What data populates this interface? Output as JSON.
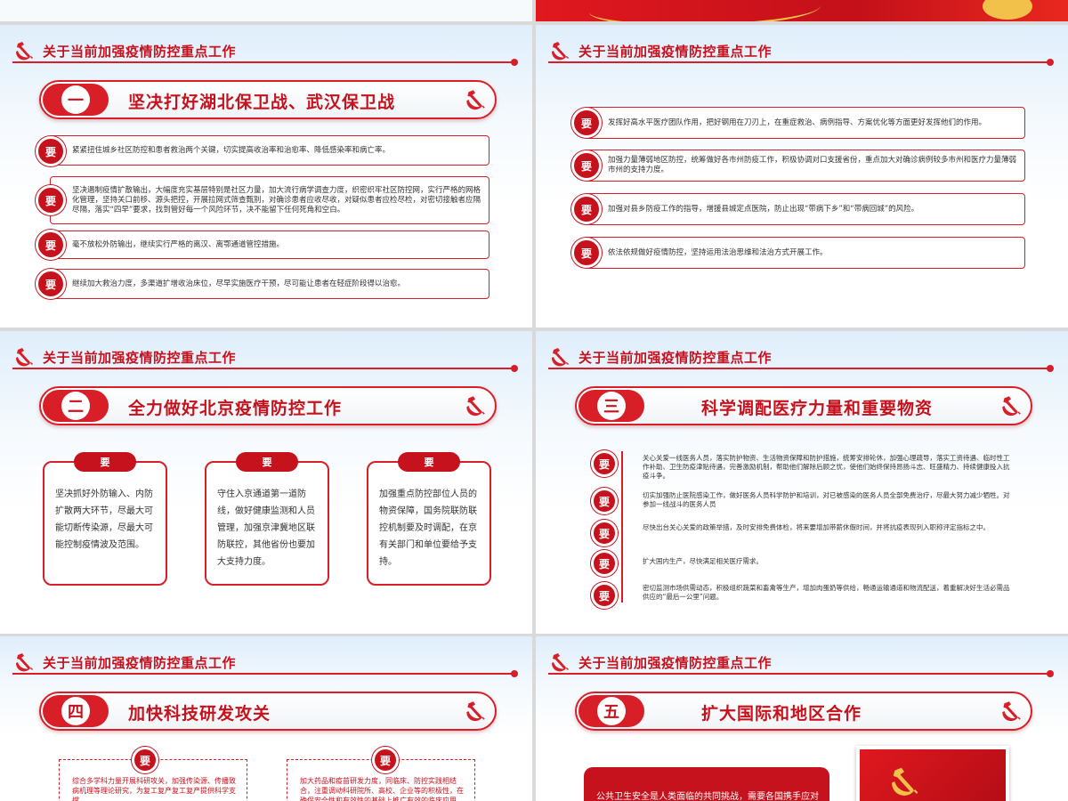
{
  "header_title": "关于当前加强疫情防控重点工作",
  "yao": "要",
  "slide1": {
    "num": "一",
    "banner": "坚决打好湖北保卫战、武汉保卫战",
    "items": [
      "紧紧扭住城乡社区防控和患者救治两个关键，切实提高收治率和治愈率、降低感染率和病亡率。",
      "坚决遏制疫情扩散输出，大幅度充实基层特别是社区力量，加大流行病学调查力度，织密织牢社区防控网，实行严格的网格化管理，坚持关口前移、源头把控，开展拉网式筛查甄别，对确诊患者应收尽收，对疑似患者应检尽检，对密切接触者应隔尽隔，落实“四早”要求，找到管好每一个风险环节，决不能留下任何死角和空白。",
      "毫不放松外防输出，继续实行严格的离汉、离鄂通道管控措施。",
      "继续加大救治力度，多渠道扩增收治床位，尽早实施医疗干预，尽可能让患者在轻症阶段得以治愈。"
    ]
  },
  "slide2": {
    "items": [
      "发挥好高水平医疗团队作用，把好钢用在刀刃上，在重症救治、病例指导、方案优化等方面更好发挥他们的作用。",
      "加强力量薄弱地区防控，统筹做好各市州防疫工作，积极协调对口支援省份，重点加大对确诊病例较多市州和医疗力量薄弱市州的支持力度。",
      "加强对县乡防疫工作的指导，增援县城定点医院，防止出现“带病下乡”和“带病回城”的风险。",
      "依法依规做好疫情防控，坚持运用法治思维和法治方式开展工作。"
    ]
  },
  "slide3": {
    "num": "二",
    "banner": "全力做好北京疫情防控工作",
    "cards": [
      "坚决抓好外防输入、内防扩散两大环节，尽最大可能切断传染源，尽最大可能控制疫情波及范围。",
      "守住入京通道第一道防线，做好健康监测和人员管理，加强京津冀地区联防联控，其他省份也要加大支持力度。",
      "加强重点防控部位人员的物资保障，国务院联防联控机制要及时调配，在京有关部门和单位要给予支持。"
    ]
  },
  "slide4": {
    "num": "三",
    "banner": "科学调配医疗力量和重要物资",
    "items": [
      "关心关爱一线医务人员，落实防护物资、生活物资保障和防护措施，统筹安排轮休，加强心理疏导，落实工资待遇、临时性工作补助、卫生防疫津贴待遇，完善激励机制，帮助他们解除后顾之忧，使他们始终保持昂扬斗志、旺盛精力、持续健康投入抗疫斗争。",
      "切实加强防止医院感染工作，做好医务人员科学防护和培训，对已被感染的医务人员全部免费治疗，尽最大努力减少牺牲。对参加一线战斗的医务人员",
      "尽快出台关心关爱的政策举措，及时安排免费体检，将来要增加带薪休假时间，并将抗疫表现列入职称评定指标之中。",
      "扩大国内生产，尽快满足相关医疗需求。",
      "密切监测市场供需动态，积极组织蔬菜和畜禽等生产，增加肉蛋奶等供给，畅通运输通道和物流配送，着重解决好生活必需品供应的“最后一公里”问题。"
    ]
  },
  "slide5": {
    "num": "四",
    "banner": "加快科技研发攻关",
    "boxes": [
      "综合多学科力量开展科研攻关，加强传染源、传播致病机理等理论研究，为复工复产复工复产提供科学支撑。",
      "加大药品和疫苗研发力度，同临床、防控实践相结合，注重调动科研院所、高校、企业等的积极性，在确保安全性和有效性的基础上推广有效的临床应用。"
    ]
  },
  "slide6": {
    "num": "五",
    "banner": "扩大国际和地区合作",
    "text": "公共卫生安全是人类面临的共同挑战，需要各国携手应对"
  },
  "colors": {
    "red": "#d81e27",
    "dark_red": "#c6121d"
  },
  "icons": [
    "hammer-sickle-emblem-icon"
  ]
}
